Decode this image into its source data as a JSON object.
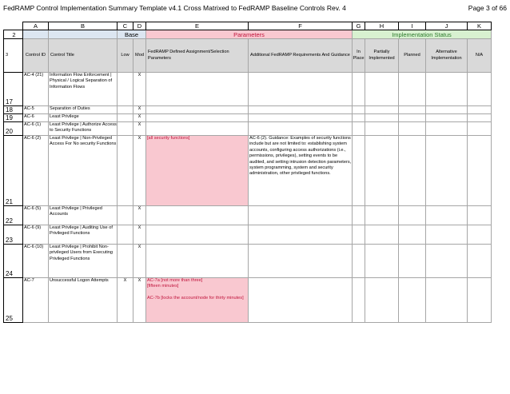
{
  "header": {
    "title": "FedRAMP Control Implementation Summary Template v4.1 Cross Matrixed to FedRAMP Baseline Controls Rev. 4",
    "page": "Page 3 of 66"
  },
  "column_letters": [
    "A",
    "B",
    "C",
    "D",
    "E",
    "F",
    "G",
    "H",
    "I",
    "J",
    "K"
  ],
  "group_header": {
    "row_number": "2",
    "base": "Base",
    "parameters": "Parameters",
    "implementation_status": "Implementation Status"
  },
  "column_headers": {
    "row_number": "3",
    "control_id": "Control ID",
    "control_title": "Control Title",
    "low": "Low",
    "mod": "Mod",
    "fedramp_params": "FedRAMP Defined Assignment/Selection Parameters",
    "additional_reqs": "Additional FedRAMP Requirements And Guidance",
    "in_place": "In Place",
    "partially": "Partially Implemented",
    "planned": "Planned",
    "alternative": "Alternative Implementation",
    "na": "N/A"
  },
  "rows": [
    {
      "num": "17",
      "id": "AC-4 (21)",
      "title": "Information Flow Enforcement | Physical / Logical Separation of Information Flows",
      "low": "",
      "mod": "X",
      "params": "",
      "guidance": ""
    },
    {
      "num": "18",
      "id": "AC-5",
      "title": "Separation of Duties",
      "low": "",
      "mod": "X",
      "params": "",
      "guidance": ""
    },
    {
      "num": "19",
      "id": "AC-6",
      "title": "Least Privilege",
      "low": "",
      "mod": "X",
      "params": "",
      "guidance": ""
    },
    {
      "num": "20",
      "id": "AC-6 (1)",
      "title": "Least Privilege | Authorize Access to Security Functions",
      "low": "",
      "mod": "X",
      "params": "",
      "guidance": ""
    },
    {
      "num": "21",
      "id": "AC-6 (2)",
      "title": "Least Privilege | Non-Privileged Access For No security Functions",
      "low": "",
      "mod": "X",
      "params": "[all security functions]",
      "guidance": "AC-6 (2). Guidance:  Examples of security functions include but are not limited to: establishing system accounts, configuring access authorizations (i.e., permissions, privileges), setting events to be audited, and setting intrusion detection parameters, system programming, system and security administration, other privileged functions."
    },
    {
      "num": "22",
      "id": "AC-6 (5)",
      "title": "Least Privilege | Privileged Accounts",
      "low": "",
      "mod": "X",
      "params": "",
      "guidance": ""
    },
    {
      "num": "23",
      "id": "AC-6 (9)",
      "title": "Least Privilege | Auditing Use of Privileged Functions",
      "low": "",
      "mod": "X",
      "params": "",
      "guidance": ""
    },
    {
      "num": "24",
      "id": "AC-6 (10)",
      "title": "Least Privilege | Prohibit Non-privileged Users from Executing Privileged Functions",
      "low": "",
      "mod": "X",
      "params": "",
      "guidance": ""
    },
    {
      "num": "25",
      "id": "AC-7",
      "title": "Unsuccessful Logon Attempts",
      "low": "X",
      "mod": "X",
      "params_lines": [
        "AC-7a [not more than three]",
        "[fifteen minutes]",
        "",
        "AC-7b [locks the account/node for thirty minutes]"
      ],
      "params": "",
      "guidance": ""
    }
  ]
}
